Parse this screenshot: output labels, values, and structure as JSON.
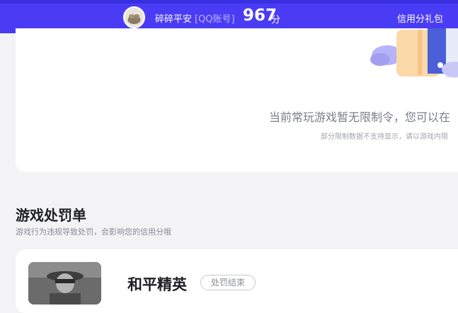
{
  "header": {
    "username": "碎碎平安",
    "account_type": "[QQ账号]",
    "score": "967",
    "score_unit": "分",
    "gift_link": "信用分礼包"
  },
  "notice": {
    "message": "当前常玩游戏暂无限制令，您可以在",
    "sub_message": "部分限制数据不支持显示，请以游戏内限"
  },
  "penalty_section": {
    "title": "游戏处罚单",
    "subtitle": "游戏行为违规导致处罚，会影响您的信用分哦",
    "items": [
      {
        "game_name": "和平精英",
        "status": "处罚结束"
      }
    ]
  },
  "colors": {
    "header_bg": "#4a3cf4",
    "page_bg": "#f3f3f6"
  }
}
